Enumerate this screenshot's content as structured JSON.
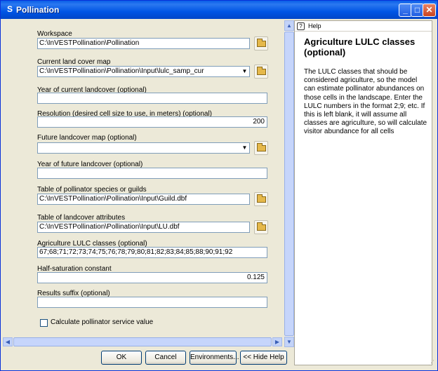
{
  "window": {
    "title": "Pollination",
    "app_icon": "S",
    "min_glyph": "_",
    "max_glyph": "□",
    "close_glyph": "✕"
  },
  "form": {
    "workspace": {
      "label": "Workspace",
      "value": "C:\\InVESTPollination\\Pollination"
    },
    "current_lc": {
      "label": "Current land cover map",
      "value": "C:\\InVESTPollination\\Pollination\\Input\\lulc_samp_cur"
    },
    "year_current": {
      "label": "Year of current landcover (optional)",
      "value": ""
    },
    "resolution": {
      "label": "Resolution (desired cell size to use, in meters) (optional)",
      "value": "200"
    },
    "future_lc": {
      "label": "Future landcover map (optional)",
      "value": ""
    },
    "year_future": {
      "label": "Year of future landcover (optional)",
      "value": ""
    },
    "guilds": {
      "label": "Table of pollinator species or guilds",
      "value": "C:\\InVESTPollination\\Pollination\\Input\\Guild.dbf"
    },
    "lc_attributes": {
      "label": "Table of landcover attributes",
      "value": "C:\\InVESTPollination\\Pollination\\Input\\LU.dbf"
    },
    "ag_classes": {
      "label": "Agriculture LULC classes (optional)",
      "value": "67;68;71;72;73;74;75;76;78;79;80;81;82;83;84;85;88;90;91;92"
    },
    "half_sat": {
      "label": "Half-saturation constant",
      "value": "0.125"
    },
    "results_suffix": {
      "label": "Results suffix (optional)",
      "value": ""
    },
    "calc_service": {
      "label": "Calculate pollinator service value",
      "checked": false
    }
  },
  "buttons": {
    "ok": "OK",
    "cancel": "Cancel",
    "environments": "Environments...",
    "hide_help": "<< Hide Help"
  },
  "help": {
    "header": "Help",
    "title": "Agriculture LULC classes (optional)",
    "body": "The LULC classes that should be considered agriculture, so the model can estimate pollinator abundances on those cells in the landscape. Enter the LULC numbers in the format 2;9; etc. If this is left blank, it will assume all classes are agriculture, so will calculate visitor abundance for all cells"
  },
  "icons": {
    "browse": "folder-icon",
    "dropdown": "chevron-down-icon",
    "help": "help-icon"
  },
  "colors": {
    "titlebar": "#0055e5",
    "field_border": "#7f9db9",
    "panel_bg": "#ece9d8"
  }
}
